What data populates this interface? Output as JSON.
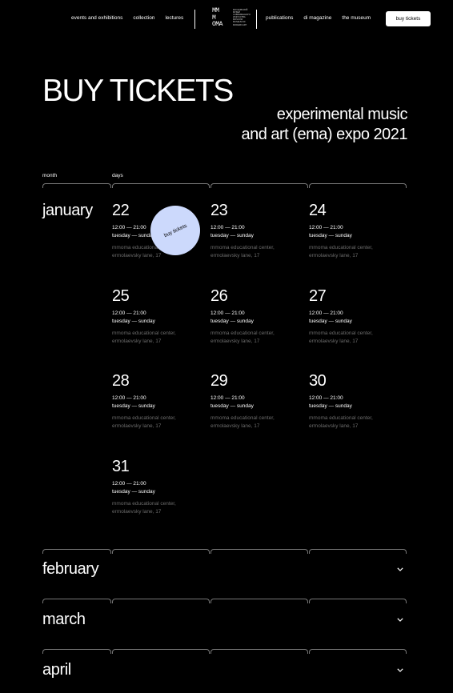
{
  "nav": {
    "left": [
      "events and exhibitions",
      "collection",
      "lectures"
    ],
    "right": [
      "publications",
      "di magazine",
      "the museum"
    ],
    "cta": "buy tickets"
  },
  "logo": {
    "mark_lines": [
      "MM",
      "M",
      "OMA"
    ],
    "fine_lines": [
      "МОСКОВСКИЙ",
      "МУЗЕЙ",
      "СОВРЕМЕННОГО",
      "ИСКУССТВА",
      "MOSCOW",
      "MUSEUM OF",
      "MODERN ART"
    ]
  },
  "hero": {
    "title": "BUY TICKETS",
    "subtitle_line1": "experimental music",
    "subtitle_line2": "and art (ema) expo 2021"
  },
  "schedule": {
    "month_label": "month",
    "days_label": "days",
    "open_month": "january",
    "time": "12:00 — 21:00",
    "weekdays": "tuesday — sunday",
    "place": "mmoma educational center,",
    "address": "ermolaevsky lane, 17",
    "days": [
      "22",
      "23",
      "24",
      "25",
      "26",
      "27",
      "28",
      "29",
      "30",
      "31"
    ],
    "badge": "buy tickets",
    "collapsed_months": [
      "february",
      "march",
      "april"
    ],
    "chevron_icon": "chevron-down-icon"
  }
}
